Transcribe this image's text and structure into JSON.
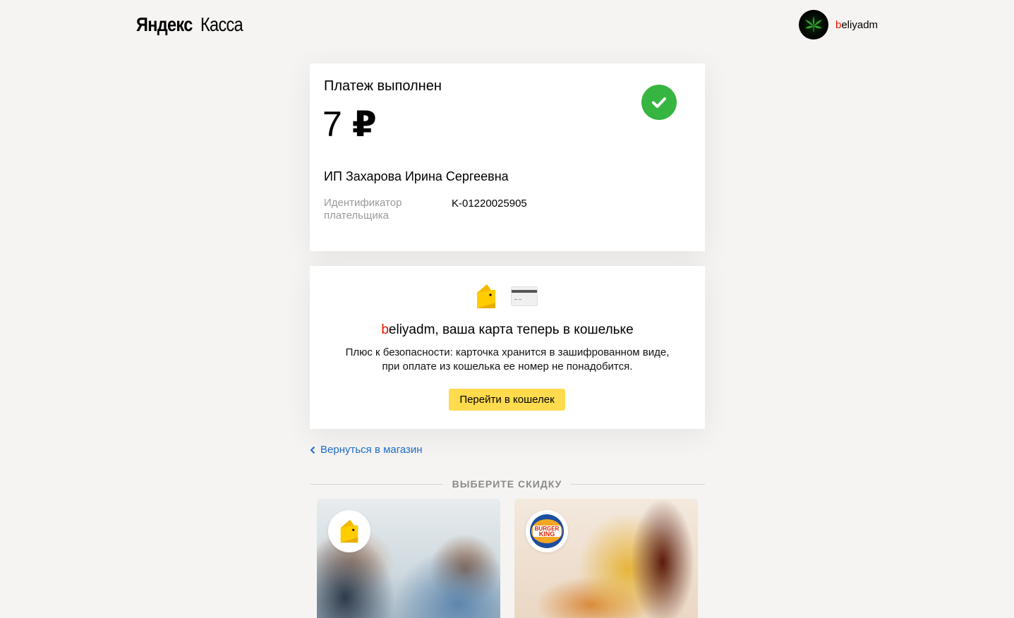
{
  "header": {
    "logo_part1": "Яндекс",
    "logo_part2": "Касса",
    "user": {
      "first_letter": "b",
      "rest": "eliyadm"
    }
  },
  "payment": {
    "status": "Платеж выполнен",
    "amount": "7",
    "currency": "₽",
    "merchant": "ИП Захарова Ирина Сергеевна",
    "payer_id_label": "Идентификатор плательщика",
    "payer_id_value": "K-01220025905",
    "status_icon": "check-circle-icon",
    "status_color": "#36b540"
  },
  "wallet": {
    "title_first_letter": "b",
    "title_rest": "eliyadm, ваша карта теперь в кошельке",
    "desc_line1": "Плюс к безопасности: карточка хранится в зашифрованном виде,",
    "desc_line2": "при оплате из кошелька ее номер не понадобится.",
    "button_label": "Перейти в кошелек",
    "button_color": "#ffdb4d",
    "icons": [
      "wallet-icon",
      "bank-card-icon"
    ]
  },
  "back_link": "Вернуться в магазин",
  "discounts": {
    "title": "ВЫБЕРИТЕ СКИДКУ",
    "cards": [
      {
        "logo": "yandex-money-logo"
      },
      {
        "logo": "burger-king-logo",
        "logo_line1": "BURGER",
        "logo_line2": "KING"
      }
    ]
  }
}
